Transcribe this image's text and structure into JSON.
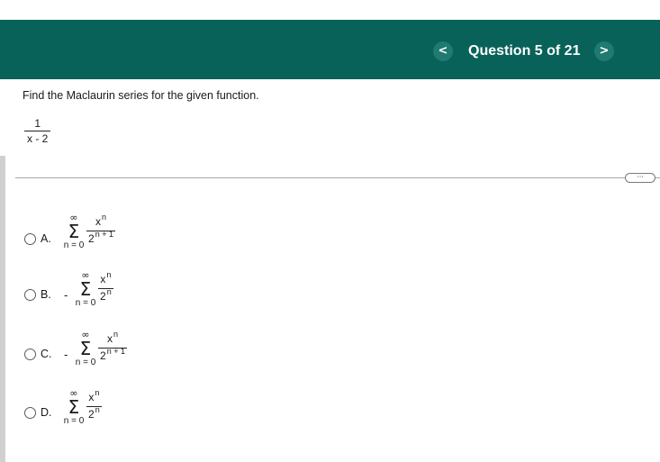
{
  "header": {
    "question_counter": "Question 5 of 21",
    "prev_icon": "<",
    "next_icon": ">"
  },
  "question": {
    "prompt": "Find the Maclaurin series for the given function.",
    "function": {
      "numerator": "1",
      "denominator": "x - 2"
    }
  },
  "more_button": {
    "label": "···"
  },
  "options": [
    {
      "letter": "A.",
      "sign": "",
      "sum_top": "∞",
      "sum_symbol": "Σ",
      "sum_bottom": "n = 0",
      "num_base": "x",
      "num_exp": "n",
      "den_base": "2",
      "den_exp": "n + 1"
    },
    {
      "letter": "B.",
      "sign": "-",
      "sum_top": "∞",
      "sum_symbol": "Σ",
      "sum_bottom": "n = 0",
      "num_base": "x",
      "num_exp": "n",
      "den_base": "2",
      "den_exp": "n"
    },
    {
      "letter": "C.",
      "sign": "-",
      "sum_top": "∞",
      "sum_symbol": "Σ",
      "sum_bottom": "n = 0",
      "num_base": "x",
      "num_exp": "n",
      "den_base": "2",
      "den_exp": "n + 1"
    },
    {
      "letter": "D.",
      "sign": "",
      "sum_top": "∞",
      "sum_symbol": "Σ",
      "sum_bottom": "n = 0",
      "num_base": "x",
      "num_exp": "n",
      "den_base": "2",
      "den_exp": "n"
    }
  ],
  "colors": {
    "header_bg": "#09625a",
    "header_text": "#ffffff",
    "nav_button_bg": "#1f7a71"
  },
  "icons": {
    "prev": "chevron-left-icon",
    "next": "chevron-right-icon",
    "more": "ellipsis-icon"
  }
}
